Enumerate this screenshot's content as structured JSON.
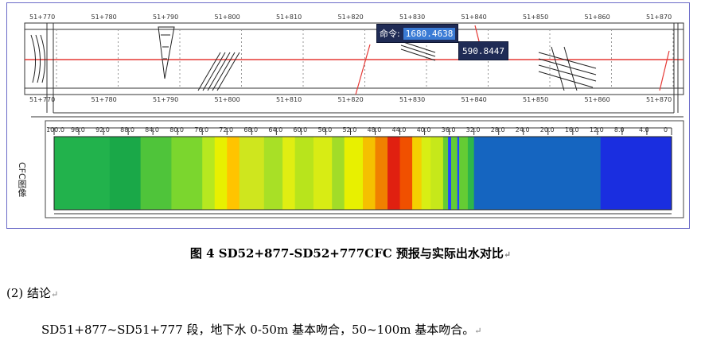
{
  "figure": {
    "top_ruler_ticks": [
      "51+770",
      "51+780",
      "51+790",
      "51+800",
      "51+810",
      "51+820",
      "51+830",
      "51+840",
      "51+850",
      "51+860",
      "51+870"
    ],
    "bottom_ruler_ticks": [
      "51+770",
      "51+780",
      "51+790",
      "51+800",
      "51+810",
      "51+820",
      "51+830",
      "51+840",
      "51+850",
      "51+860",
      "51+870"
    ],
    "command_label": "命令:",
    "command_value": "1680.4638",
    "value_popup": "590.8447",
    "cfc_label": "CFC图像",
    "scale_ticks": [
      "100.0",
      "96.0",
      "92.0",
      "88.0",
      "84.0",
      "80.0",
      "76.0",
      "72.0",
      "68.0",
      "64.0",
      "60.0",
      "56.0",
      "52.0",
      "48.0",
      "44.0",
      "40.0",
      "36.0",
      "32.0",
      "28.0",
      "24.0",
      "20.0",
      "16.0",
      "12.0",
      "8.0",
      "4.0",
      "0"
    ],
    "colors": {
      "frame": "#6b6bc8",
      "red_line": "#e53935",
      "blue": "#1565c0",
      "deep_blue": "#1a2ee0",
      "green": "#22b24c",
      "yellow": "#f4f000",
      "red": "#e02010"
    }
  },
  "caption": "图 4   SD52+877-SD52+777CFC 预报与实际出水对比",
  "conclusion_heading": "(2) 结论",
  "conclusion_body": "SD51+877~SD51+777 段，地下水 0-50m 基本吻合，50~100m 基本吻合。",
  "paragraph_mark": "↵"
}
